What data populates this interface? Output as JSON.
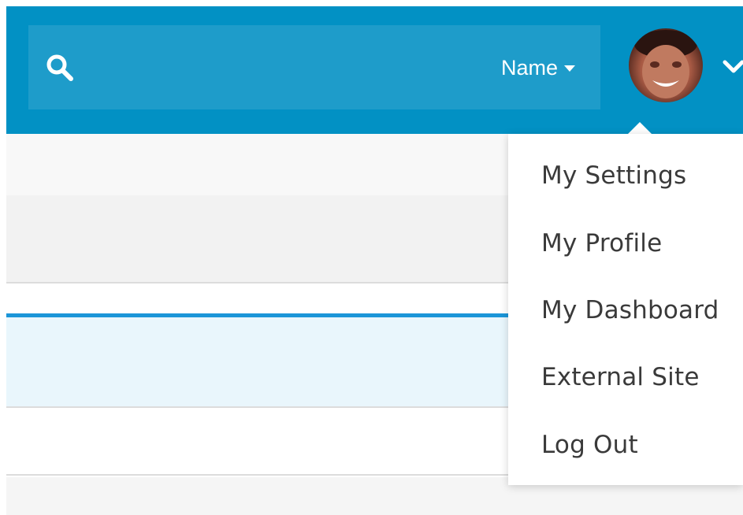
{
  "header": {
    "search": {
      "placeholder": "",
      "value": "",
      "filter_label": "Name",
      "search_icon": "search-icon",
      "filter_icon": "caret-down-icon"
    },
    "user": {
      "avatar": "avatar",
      "menu_icon": "chevron-down-icon"
    }
  },
  "user_menu": {
    "items": [
      {
        "label": "My Settings"
      },
      {
        "label": "My Profile"
      },
      {
        "label": "My Dashboard"
      },
      {
        "label": "External Site"
      },
      {
        "label": "Log Out"
      }
    ]
  },
  "colors": {
    "header_bg": "#0291c4",
    "search_bg": "#1e9cca",
    "accent": "#1b95d8",
    "selected_row_bg": "#e9f6fc",
    "menu_text": "#3a3a3a"
  }
}
